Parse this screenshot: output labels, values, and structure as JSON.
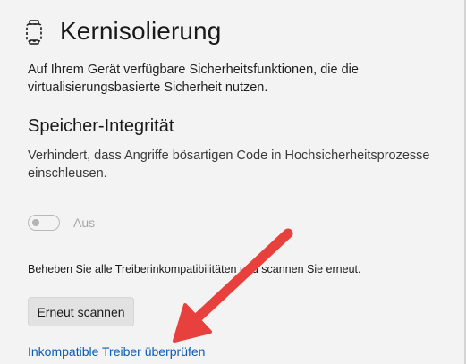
{
  "header": {
    "icon": "chip-dashed-icon",
    "title": "Kernisolierung"
  },
  "intro": {
    "text": "Auf Ihrem Gerät verfügbare Sicherheitsfunktionen, die die virtualisierungsbasierte Sicherheit nutzen."
  },
  "memory_integrity": {
    "title": "Speicher-Integrität",
    "description": "Verhindert, dass Angriffe bösartigen Code in Hochsicherheitsprozesse einschleusen.",
    "toggle_state": "off",
    "toggle_label": "Aus"
  },
  "drivers": {
    "instruction": "Beheben Sie alle Treiberinkompatibilitäten und scannen Sie erneut.",
    "scan_button_label": "Erneut scannen",
    "review_link_label": "Inkompatible Treiber überprüfen"
  },
  "annotation": {
    "arrow_color": "#e8403c"
  }
}
